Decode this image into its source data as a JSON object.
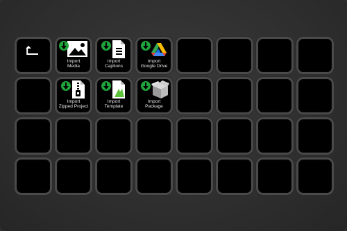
{
  "deck": {
    "back_label": "",
    "keys": [
      {
        "id": "import-media",
        "line1": "Import",
        "line2": "Media",
        "icon": "image-icon"
      },
      {
        "id": "import-captions",
        "line1": "Import",
        "line2": "Captions",
        "icon": "document-icon"
      },
      {
        "id": "import-google-drive",
        "line1": "Import",
        "line2": "Google Drive",
        "icon": "google-drive-icon"
      },
      {
        "id": "import-zipped-project",
        "line1": "Import",
        "line2": "Zipped Project",
        "icon": "zip-file-icon"
      },
      {
        "id": "import-template",
        "line1": "Import",
        "line2": "Template",
        "icon": "template-icon"
      },
      {
        "id": "import-package",
        "line1": "Import",
        "line2": "Package",
        "icon": "package-box-icon"
      }
    ],
    "colors": {
      "import_arrow": "#1fa33a",
      "key_bg": "#000000",
      "bezel": "#4a4a4a",
      "template_badge": "#5cc23a"
    }
  }
}
